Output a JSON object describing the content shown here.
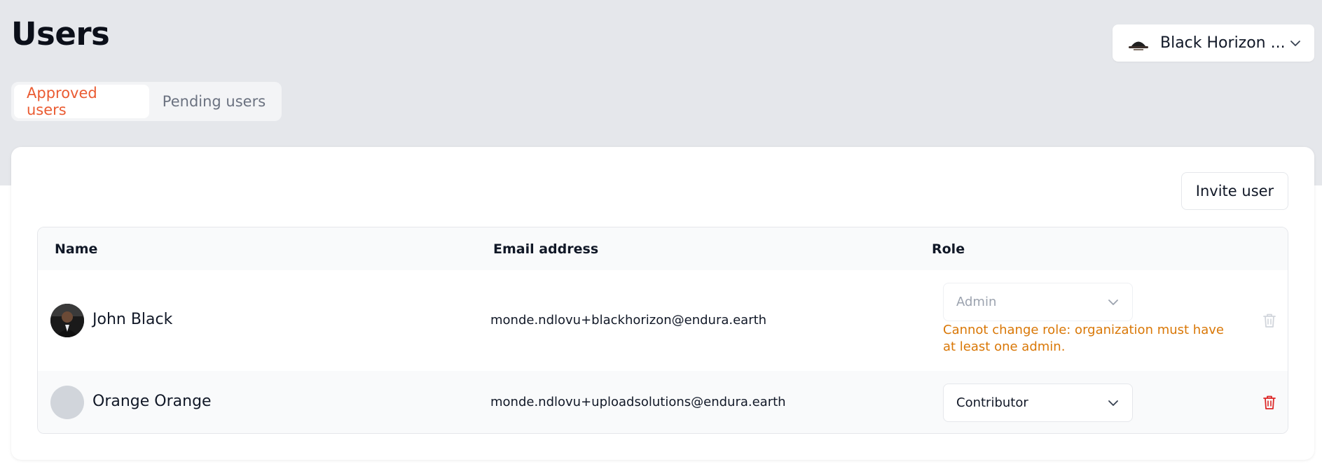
{
  "page": {
    "title": "Users"
  },
  "org_selector": {
    "name": "Black Horizon ..."
  },
  "tabs": [
    {
      "label": "Approved users",
      "active": true
    },
    {
      "label": "Pending users",
      "active": false
    }
  ],
  "actions": {
    "invite_label": "Invite user"
  },
  "table": {
    "columns": [
      "Name",
      "Email address",
      "Role"
    ],
    "rows": [
      {
        "name": "John Black",
        "email": "monde.ndlovu+blackhorizon@endura.earth",
        "role": "Admin",
        "role_disabled": true,
        "error": "Cannot change role: organization must have at least one admin."
      },
      {
        "name": "Orange Orange",
        "email": "monde.ndlovu+uploadsolutions@endura.earth",
        "role": "Contributor",
        "role_disabled": false
      }
    ]
  },
  "colors": {
    "accent": "#ea5b32",
    "error": "#d97706",
    "delete": "#dc2626",
    "delete_disabled": "#d1d5db"
  },
  "icons": {
    "org": "org-logo-icon",
    "chevron": "chevron-down-icon",
    "delete": "trash-icon"
  }
}
